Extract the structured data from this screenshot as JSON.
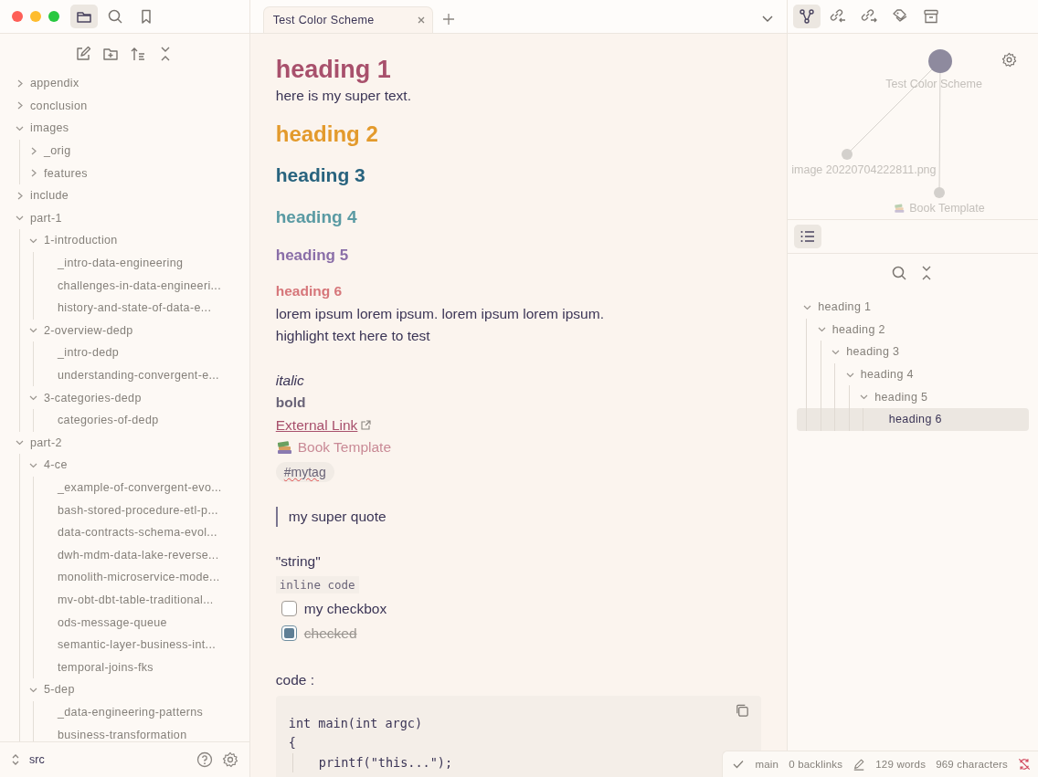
{
  "vault": {
    "name": "src"
  },
  "file_tree": [
    {
      "label": "appendix",
      "expanded": false
    },
    {
      "label": "conclusion",
      "expanded": false
    },
    {
      "label": "images",
      "expanded": true,
      "children": [
        {
          "label": "_orig",
          "expanded": false
        },
        {
          "label": "features",
          "expanded": false
        }
      ]
    },
    {
      "label": "include",
      "expanded": false
    },
    {
      "label": "part-1",
      "expanded": true,
      "children": [
        {
          "label": "1-introduction",
          "expanded": true,
          "children": [
            {
              "label": "_intro-data-engineering"
            },
            {
              "label": "challenges-in-data-engineeri..."
            },
            {
              "label": "history-and-state-of-data-e..."
            }
          ]
        },
        {
          "label": "2-overview-dedp",
          "expanded": true,
          "children": [
            {
              "label": "_intro-dedp"
            },
            {
              "label": "understanding-convergent-e..."
            }
          ]
        },
        {
          "label": "3-categories-dedp",
          "expanded": true,
          "children": [
            {
              "label": "categories-of-dedp"
            }
          ]
        }
      ]
    },
    {
      "label": "part-2",
      "expanded": true,
      "children": [
        {
          "label": "4-ce",
          "expanded": true,
          "children": [
            {
              "label": "_example-of-convergent-evo..."
            },
            {
              "label": "bash-stored-procedure-etl-p..."
            },
            {
              "label": "data-contracts-schema-evol..."
            },
            {
              "label": "dwh-mdm-data-lake-reverse..."
            },
            {
              "label": "monolith-microservice-mode..."
            },
            {
              "label": "mv-obt-dbt-table-traditional..."
            },
            {
              "label": "ods-message-queue"
            },
            {
              "label": "semantic-layer-business-int..."
            },
            {
              "label": "temporal-joins-fks"
            }
          ]
        },
        {
          "label": "5-dep",
          "expanded": true,
          "children": [
            {
              "label": "_data-engineering-patterns"
            },
            {
              "label": "business-transformation"
            }
          ]
        }
      ]
    }
  ],
  "tabs": [
    {
      "label": "Test Color Scheme",
      "selected": true
    }
  ],
  "document": [
    {
      "kind": "h1",
      "text": "heading 1"
    },
    {
      "kind": "paragraph",
      "text": "here is my super text."
    },
    {
      "kind": "h2",
      "text": "heading 2"
    },
    {
      "kind": "h3",
      "text": "heading 3"
    },
    {
      "kind": "h4",
      "text": "heading 4"
    },
    {
      "kind": "h5",
      "text": "heading 5"
    },
    {
      "kind": "h6",
      "text": "heading 6"
    },
    {
      "kind": "paragraph",
      "text": "lorem ipsum lorem ipsum. lorem ipsum lorem ipsum."
    },
    {
      "kind": "paragraph",
      "text": "highlight text here to test"
    },
    {
      "kind": "italic",
      "text": "italic"
    },
    {
      "kind": "bold",
      "text": "bold"
    },
    {
      "kind": "external_link",
      "text": "External Link"
    },
    {
      "kind": "internal_link",
      "text": "Book Template"
    },
    {
      "kind": "tag",
      "text": "#mytag"
    },
    {
      "kind": "quote",
      "text": "my super quote"
    },
    {
      "kind": "string",
      "text": "\"string\""
    },
    {
      "kind": "inline_code",
      "text": "inline code"
    },
    {
      "kind": "task",
      "text": "my checkbox",
      "checked": false
    },
    {
      "kind": "task",
      "text": "checked",
      "checked": true
    },
    {
      "kind": "code_label",
      "text": "code :"
    },
    {
      "kind": "code_block",
      "lines": [
        "int main(int argc)",
        "{",
        "printf(\"this...\");"
      ]
    }
  ],
  "graph": {
    "nodes": [
      {
        "label": "Test Color Scheme",
        "kind": "current"
      },
      {
        "label": "image 20220704222811.png",
        "kind": "attachment"
      },
      {
        "label": "Book Template",
        "kind": "note"
      }
    ]
  },
  "outline": [
    {
      "label": "heading 1",
      "expanded": true,
      "selected": false,
      "children": [
        {
          "label": "heading 2",
          "expanded": true,
          "selected": false,
          "children": [
            {
              "label": "heading 3",
              "expanded": true,
              "selected": false,
              "children": [
                {
                  "label": "heading 4",
                  "expanded": true,
                  "selected": false,
                  "children": [
                    {
                      "label": "heading 5",
                      "expanded": true,
                      "selected": false,
                      "children": [
                        {
                          "label": "heading 6",
                          "selected": true
                        }
                      ]
                    }
                  ]
                }
              ]
            }
          ]
        }
      ]
    }
  ],
  "status_bar": {
    "branch": "main",
    "backlinks": "0 backlinks",
    "words": "129 words",
    "characters": "969 characters"
  }
}
